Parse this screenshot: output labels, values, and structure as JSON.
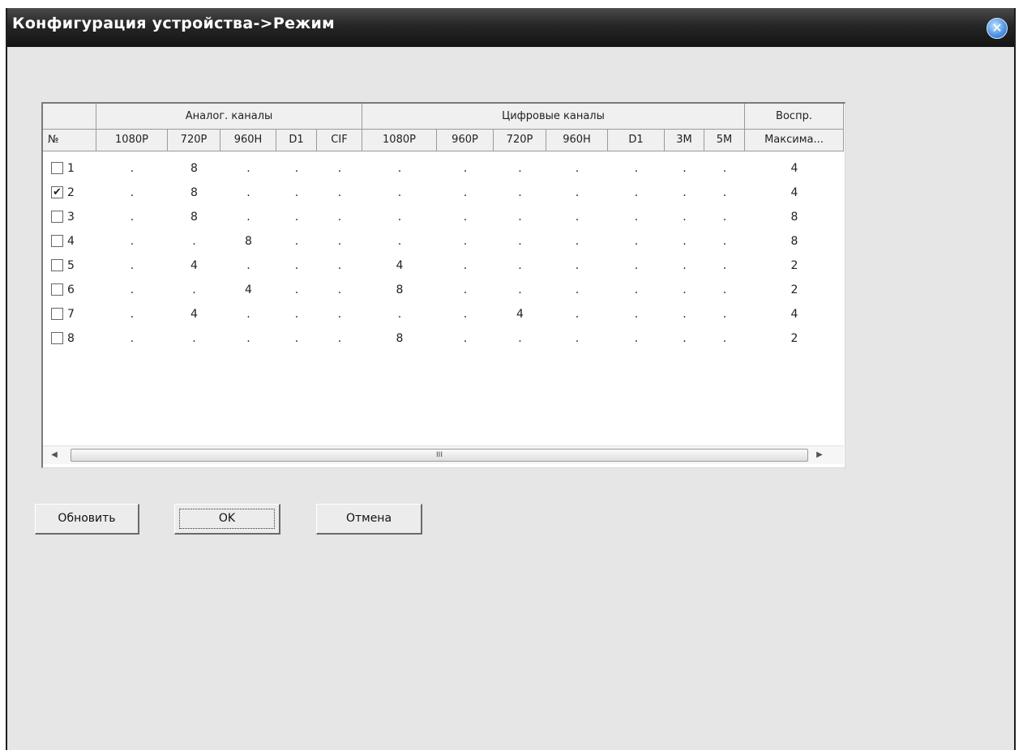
{
  "window": {
    "title": "Конфигурация устройства->Режим",
    "close_icon": "close-icon"
  },
  "table": {
    "groups": [
      {
        "label": "Аналог. каналы"
      },
      {
        "label": "Цифровые каналы"
      },
      {
        "label": "Воспр."
      }
    ],
    "columns": [
      "№",
      "1080P",
      "720P",
      "960H",
      "D1",
      "CIF",
      "1080P",
      "960P",
      "720P",
      "960H",
      "D1",
      "3M",
      "5M",
      "Максима..."
    ],
    "rows": [
      {
        "no": "1",
        "checked": false,
        "cells": [
          ".",
          "8",
          ".",
          ".",
          ".",
          ".",
          ".",
          ".",
          ".",
          ".",
          ".",
          ".",
          "4"
        ]
      },
      {
        "no": "2",
        "checked": true,
        "cells": [
          ".",
          "8",
          ".",
          ".",
          ".",
          ".",
          ".",
          ".",
          ".",
          ".",
          ".",
          ".",
          "4"
        ]
      },
      {
        "no": "3",
        "checked": false,
        "cells": [
          ".",
          "8",
          ".",
          ".",
          ".",
          ".",
          ".",
          ".",
          ".",
          ".",
          ".",
          ".",
          "8"
        ]
      },
      {
        "no": "4",
        "checked": false,
        "cells": [
          ".",
          ".",
          "8",
          ".",
          ".",
          ".",
          ".",
          ".",
          ".",
          ".",
          ".",
          ".",
          "8"
        ]
      },
      {
        "no": "5",
        "checked": false,
        "cells": [
          ".",
          "4",
          ".",
          ".",
          ".",
          "4",
          ".",
          ".",
          ".",
          ".",
          ".",
          ".",
          "2"
        ]
      },
      {
        "no": "6",
        "checked": false,
        "cells": [
          ".",
          ".",
          "4",
          ".",
          ".",
          "8",
          ".",
          ".",
          ".",
          ".",
          ".",
          ".",
          "2"
        ]
      },
      {
        "no": "7",
        "checked": false,
        "cells": [
          ".",
          "4",
          ".",
          ".",
          ".",
          ".",
          ".",
          "4",
          ".",
          ".",
          ".",
          ".",
          "4"
        ]
      },
      {
        "no": "8",
        "checked": false,
        "cells": [
          ".",
          ".",
          ".",
          ".",
          ".",
          "8",
          ".",
          ".",
          ".",
          ".",
          ".",
          ".",
          "2"
        ]
      }
    ],
    "scroll_thumb_text": "III"
  },
  "buttons": {
    "refresh": "Обновить",
    "ok": "OK",
    "cancel": "Отмена"
  }
}
